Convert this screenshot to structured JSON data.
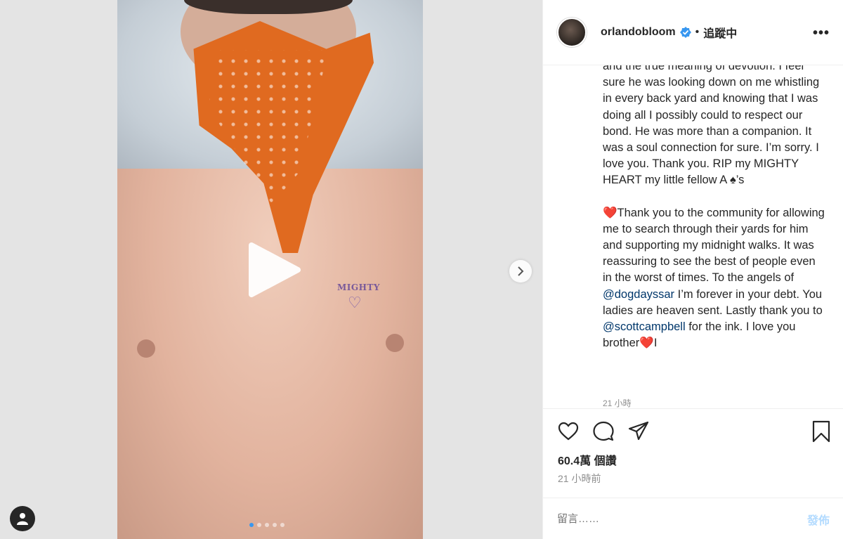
{
  "post": {
    "username": "orlandobloom",
    "follow_status": "追蹤中",
    "caption_paragraphs": [
      [
        {
          "t": "and the true meaning of devotion. I feel sure he was looking down on me whistling in every back yard and knowing that I was doing all I possibly could to respect our bond. He was more than a companion. It was a soul connection for sure. I’m sorry. I love you. Thank you. RIP my MIGHTY HEART my little fellow A ♠’s"
        }
      ],
      [
        {
          "t": "❤️",
          "cls": "heart-red"
        },
        {
          "t": "Thank you to the community for allowing me to search through their yards for him and supporting my midnight walks. It was reassuring to see the best of people even in the worst of times. To the angels of "
        },
        {
          "t": "@dogdayssar",
          "cls": "mention"
        },
        {
          "t": " I’m forever in your debt. You ladies are heaven sent. Lastly thank you to "
        },
        {
          "t": "@scottcampbell",
          "cls": "mention"
        },
        {
          "t": " for the ink. I love you brother"
        },
        {
          "t": "❤️",
          "cls": "heart-red"
        },
        {
          "t": "I"
        }
      ]
    ],
    "caption_time": "21 小時",
    "views": "60.4萬 個讚",
    "timestamp": "21 小時前",
    "comment_placeholder": "留言……",
    "post_button": "發佈"
  },
  "media": {
    "tattoo_text": "MIGHTY",
    "carousel_count": 5,
    "carousel_active_index": 0
  },
  "colors": {
    "link": "#00376b",
    "verified": "#3897f0",
    "post_disabled": "#b3dbff",
    "bandana": "#e06a20"
  },
  "icons": [
    "play-icon",
    "chevron-right-icon",
    "user-icon",
    "verified-icon",
    "more-icon",
    "heart-icon",
    "comment-icon",
    "share-icon",
    "bookmark-icon"
  ]
}
